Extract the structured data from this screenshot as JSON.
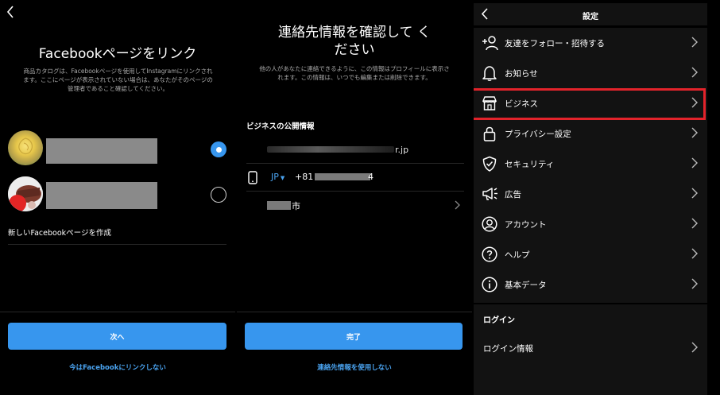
{
  "panel1": {
    "title": "Facebookページをリンク",
    "description": "商品カタログは、Facebookページを使用してInstagramにリンクされます。ここにページが表示されていない場合は、あなたがそのページの管理者であること確認してください。",
    "pages": [
      {
        "avatar": "yellow-rose",
        "selected": true
      },
      {
        "avatar": "red-cake",
        "selected": false
      }
    ],
    "create_page_label": "新しいFacebookページを作成",
    "next_button": "次へ",
    "skip_link": "今はFacebookにリンクしない"
  },
  "panel2": {
    "title": "連絡先情報を確認して ください",
    "description": "他の人があなたに連絡できるように、この情報はプロフィールに表示されます。この情報は、いつでも編集または削除できます。",
    "section_header": "ビジネスの公開情報",
    "email_suffix": "r.jp",
    "country_code": "JP",
    "phone_prefix": "+81",
    "phone_suffix": "4",
    "city_suffix": "市",
    "done_button": "完了",
    "skip_link": "連絡先情報を使用しない"
  },
  "panel3": {
    "title": "設定",
    "items": [
      {
        "label": "友達をフォロー・招待する",
        "icon": "add-person-icon"
      },
      {
        "label": "お知らせ",
        "icon": "bell-icon"
      },
      {
        "label": "ビジネス",
        "icon": "shop-icon",
        "highlighted": true
      },
      {
        "label": "プライバシー設定",
        "icon": "lock-icon"
      },
      {
        "label": "セキュリティ",
        "icon": "shield-icon"
      },
      {
        "label": "広告",
        "icon": "megaphone-icon"
      },
      {
        "label": "アカウント",
        "icon": "account-icon"
      },
      {
        "label": "ヘルプ",
        "icon": "help-icon"
      },
      {
        "label": "基本データ",
        "icon": "info-icon"
      }
    ],
    "login_section": "ログイン",
    "login_info": "ログイン情報"
  },
  "colors": {
    "accent": "#3796ee",
    "link": "#4aa3f0",
    "highlight": "#e3232b",
    "background": "#000000"
  }
}
